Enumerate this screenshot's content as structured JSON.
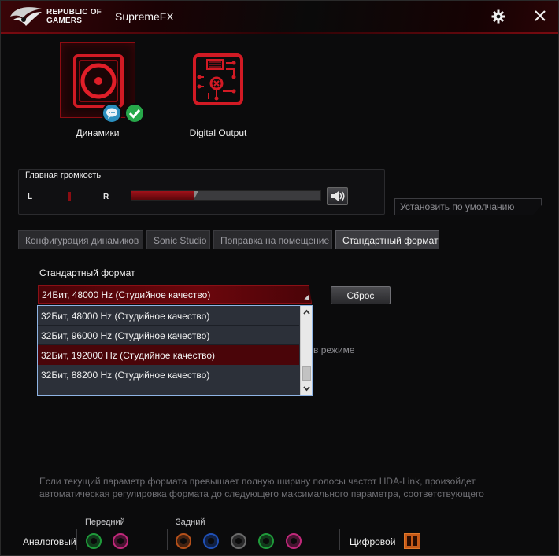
{
  "window": {
    "brand": [
      "REPUBLIC OF",
      "GAMERS"
    ],
    "title": "SupremeFX",
    "icons": {
      "settings": "gear-icon",
      "close": "close-icon"
    }
  },
  "devices": [
    {
      "label": "Динамики",
      "icon": "speaker-icon",
      "selected": true
    },
    {
      "label": "Digital Output",
      "icon": "digital-output-icon",
      "selected": false
    }
  ],
  "volume": {
    "title": "Главная громкость",
    "balance_left": "L",
    "balance_right": "R",
    "level_fraction": 0.33,
    "balance_fraction": 0.5
  },
  "default_button": "Установить по умолчанию",
  "tabs": [
    "Конфигурация динамиков",
    "Sonic Studio",
    "Поправка на помещение",
    "Стандартный формат"
  ],
  "format": {
    "label": "Стандартный формат",
    "selected": "24Бит, 48000 Hz (Студийное качество)",
    "reset_label": "Сброс",
    "options": [
      "32Бит, 48000 Hz (Студийное качество)",
      "32Бит, 96000 Hz (Студийное качество)",
      "32Бит, 192000 Hz (Студийное качество)",
      "32Бит, 88200 Hz (Студийное качество)"
    ],
    "highlighted_index": 2,
    "behind_text": "в режиме"
  },
  "info": "Если текущий параметр формата превышает полную ширину полосы частот HDA-Link, произойдет автоматическая регулировка формата до следующего максимального параметра, соответствующего",
  "jacks": {
    "front_label": "Передний",
    "rear_label": "Задний",
    "analog_label": "Аналоговый",
    "digital_label": "Цифровой",
    "front_colors": [
      "#1f9a3a",
      "#c0287a"
    ],
    "rear_colors": [
      "#b5501a",
      "#1f4fb5",
      "#6a6a6a",
      "#1f9a3a",
      "#c0287a"
    ]
  },
  "colors": {
    "accent": "#8b0d12",
    "selection": "#4a0509"
  }
}
